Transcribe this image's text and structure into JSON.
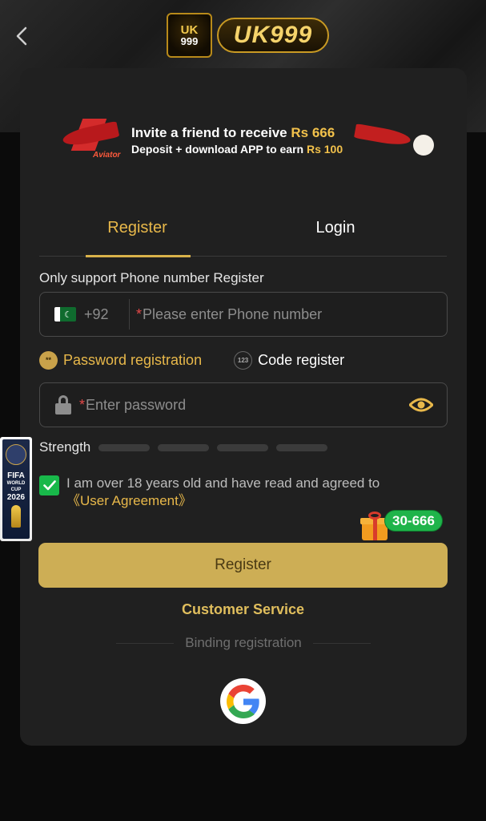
{
  "brand": {
    "badge_top": "UK",
    "badge_bottom": "999",
    "wordmark": "UK999"
  },
  "banner": {
    "line1_prefix": "Invite a friend to receive ",
    "line1_amount": "Rs 666",
    "line2_prefix": "Deposit + download APP to earn ",
    "line2_amount": "Rs 100",
    "plane_tag": "Aviator"
  },
  "tabs": [
    {
      "label": "Register",
      "active": true
    },
    {
      "label": "Login",
      "active": false
    }
  ],
  "phone": {
    "label": "Only support Phone number Register",
    "country_code": "+92",
    "required_mark": "*",
    "placeholder": "Please enter Phone number"
  },
  "modes": {
    "password": {
      "icon": "**",
      "label": "Password registration"
    },
    "code": {
      "icon": "123",
      "label": "Code register"
    }
  },
  "password": {
    "required_mark": "*",
    "placeholder": "Enter password"
  },
  "strength": {
    "label": "Strength"
  },
  "agreement": {
    "checked": true,
    "text": "I am over 18 years old and have read and agreed to",
    "link": "《User Agreement》"
  },
  "promo_badge": "30-666",
  "register_button": "Register",
  "customer_service": "Customer Service",
  "binding_label": "Binding registration",
  "side_ad": {
    "title": "FIFA",
    "sub": "WORLD CUP",
    "year": "2026"
  },
  "colors": {
    "accent": "#e8b84a",
    "button": "#cdae55",
    "check": "#18b84a",
    "card": "#202020"
  }
}
